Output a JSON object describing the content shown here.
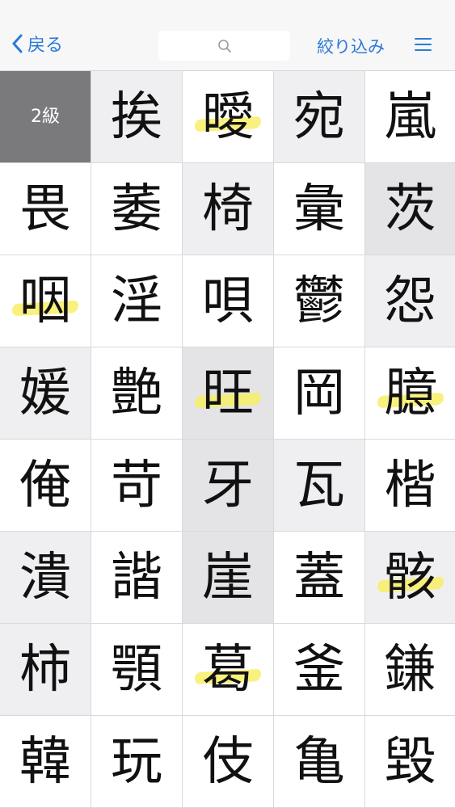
{
  "nav": {
    "back_label": "戻る",
    "filter_label": "絞り込み"
  },
  "colors": {
    "accent": "#2a7ad8",
    "highlight": "#f7ee66",
    "level_cell": "#7a7a7c"
  },
  "grid": {
    "rows": [
      [
        "2級",
        "挨",
        "曖",
        "宛",
        "嵐"
      ],
      [
        "畏",
        "萎",
        "椅",
        "彙",
        "茨"
      ],
      [
        "咽",
        "淫",
        "唄",
        "鬱",
        "怨"
      ],
      [
        "媛",
        "艶",
        "旺",
        "岡",
        "臆"
      ],
      [
        "俺",
        "苛",
        "牙",
        "瓦",
        "楷"
      ],
      [
        "潰",
        "諧",
        "崖",
        "蓋",
        "骸"
      ],
      [
        "柿",
        "顎",
        "葛",
        "釜",
        "鎌"
      ],
      [
        "韓",
        "玩",
        "伎",
        "亀",
        "毀"
      ]
    ],
    "highlighted": [
      "曖",
      "咽",
      "旺",
      "臆",
      "骸",
      "葛"
    ]
  }
}
